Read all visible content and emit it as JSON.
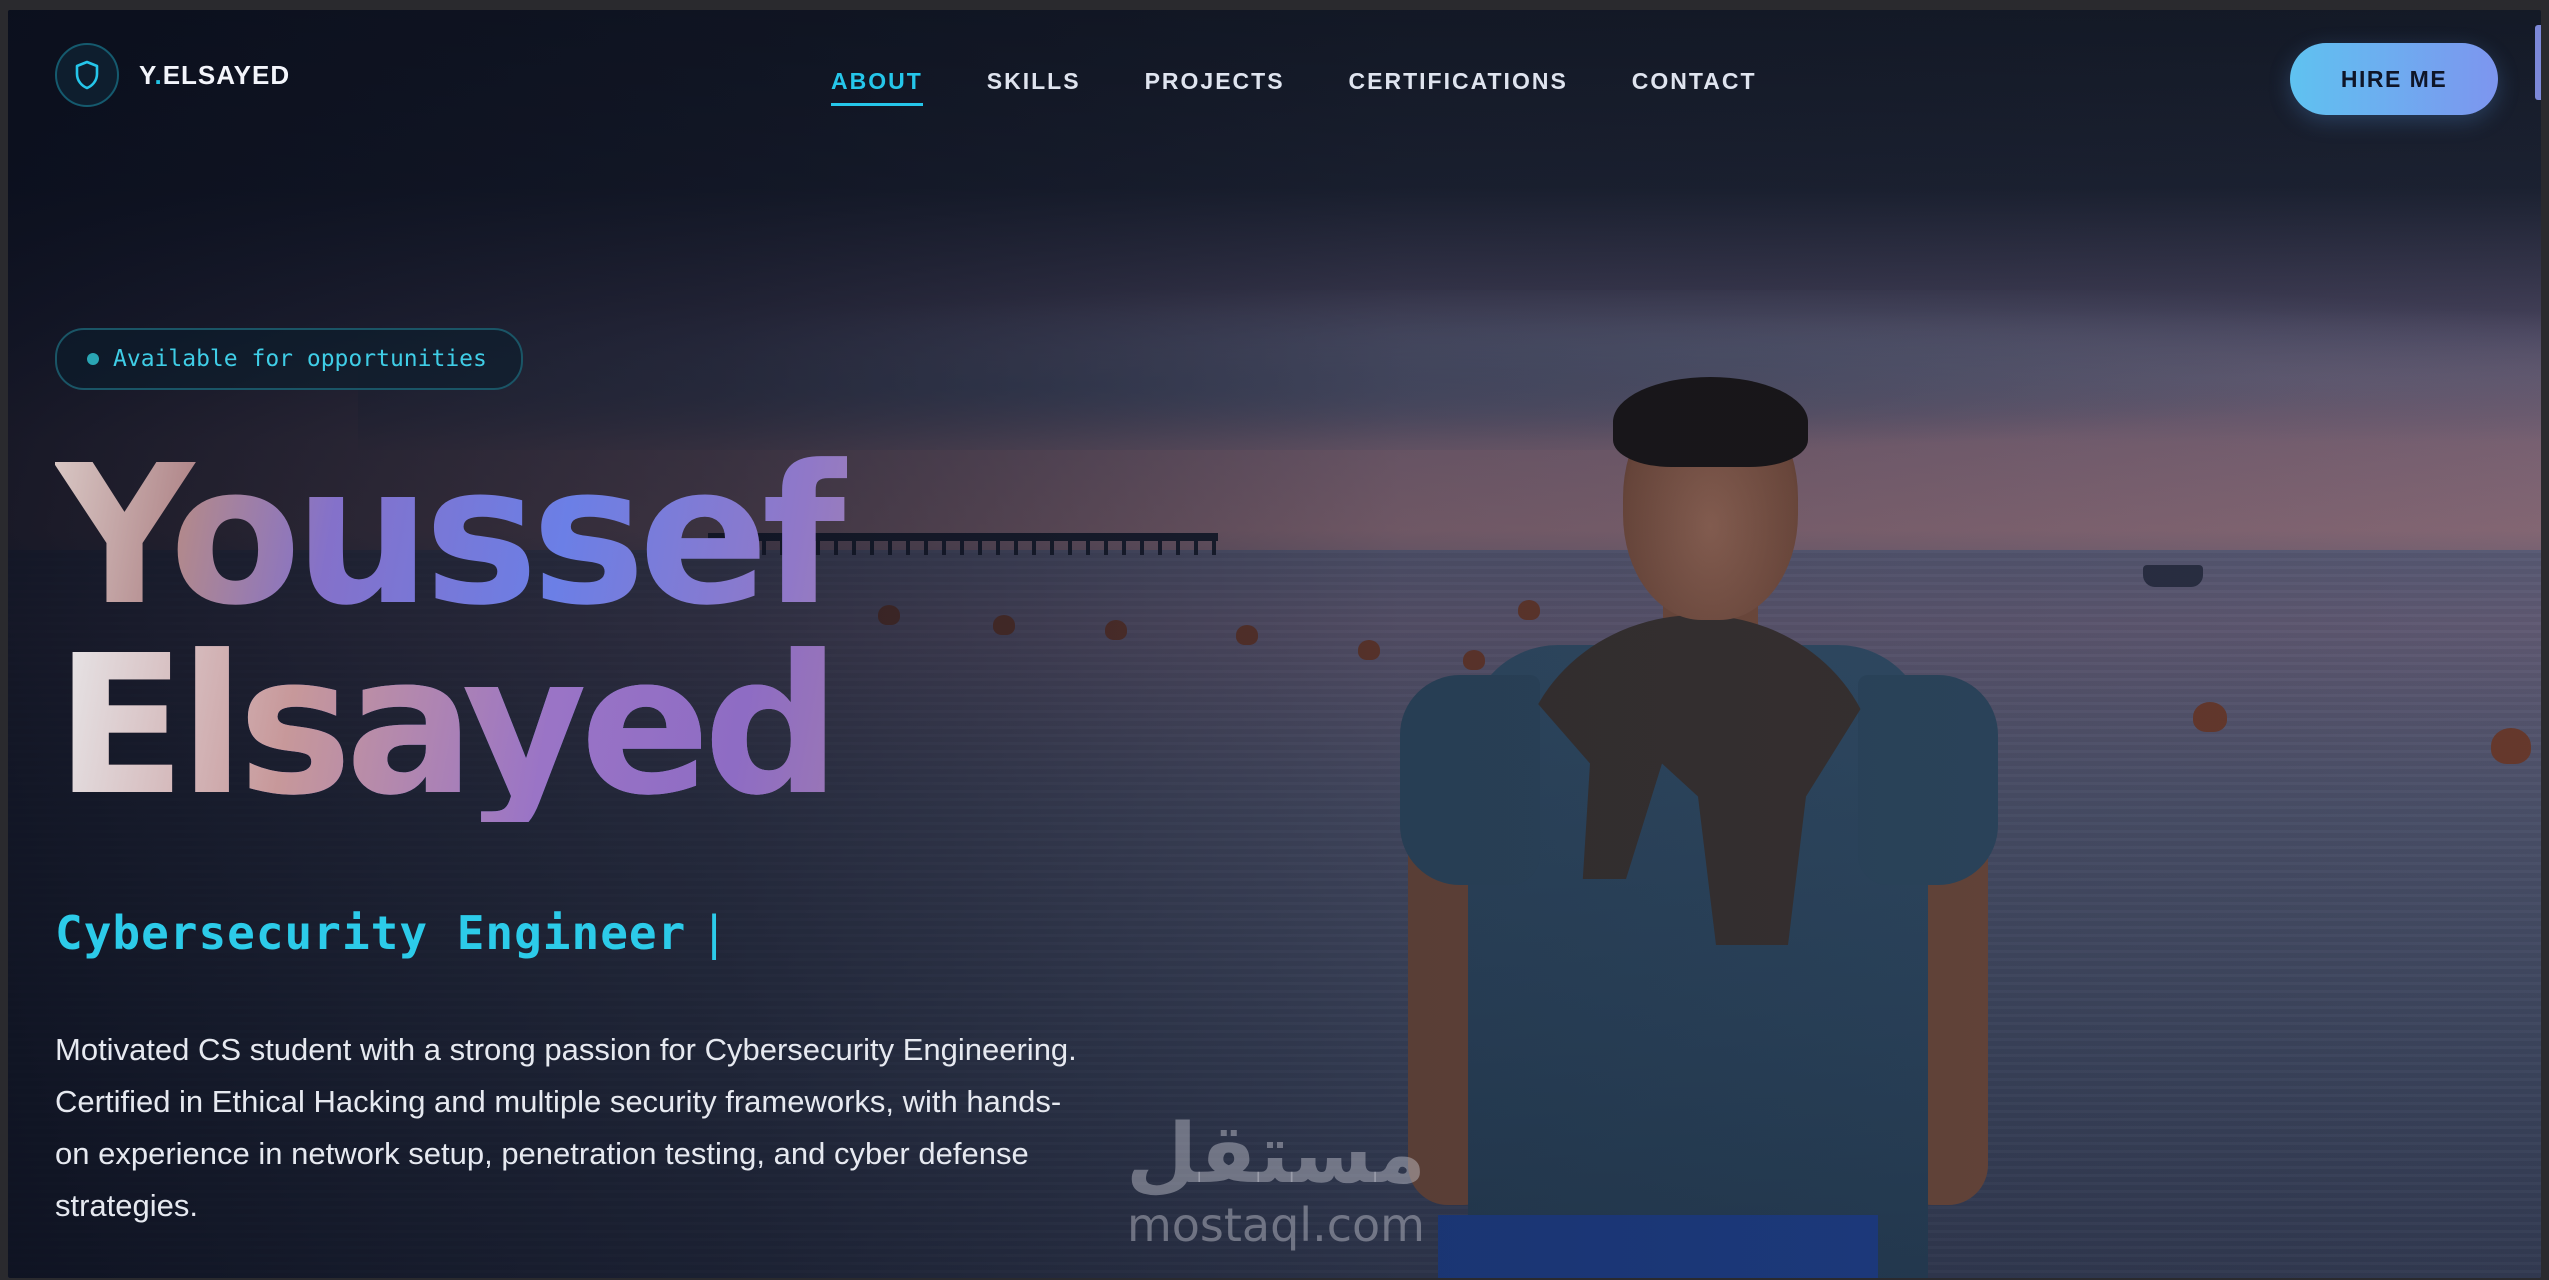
{
  "brand": {
    "logo_prefix": "Y",
    "logo_dot": ".",
    "logo_suffix": "ELSAYED",
    "logo_icon": "shield-icon"
  },
  "nav": {
    "items": [
      {
        "label": "ABOUT",
        "active": true
      },
      {
        "label": "SKILLS",
        "active": false
      },
      {
        "label": "PROJECTS",
        "active": false
      },
      {
        "label": "CERTIFICATIONS",
        "active": false
      },
      {
        "label": "CONTACT",
        "active": false
      }
    ],
    "cta_label": "HIRE ME"
  },
  "hero": {
    "status": "Available for opportunities",
    "first_name": "Youssef",
    "last_name": "Elsayed",
    "role": "Cybersecurity Engineer",
    "role_cursor": "|",
    "bio": "Motivated CS student with a strong passion for Cybersecurity Engineering. Certified in Ethical Hacking and multiple security frameworks, with hands-on experience in network setup, penetration testing, and cyber defense strategies."
  },
  "watermark": {
    "arabic": "مستقل",
    "latin": "mostaql.com"
  },
  "colors": {
    "accent": "#25c6ea",
    "cta_gradient_start": "#5fc2f0",
    "cta_gradient_end": "#7d95ef",
    "background": "#141a27"
  }
}
